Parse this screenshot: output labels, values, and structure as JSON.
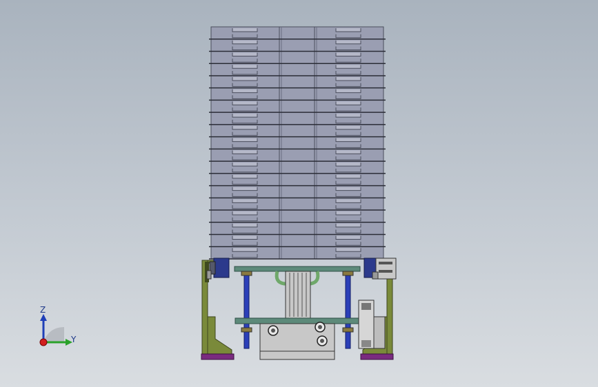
{
  "viewport": {
    "background_top": "#a9b3be",
    "background_bottom": "#d9dde1"
  },
  "model": {
    "trays": {
      "count": 19
    },
    "colors": {
      "tray_fill": "#9a9eb2",
      "tray_line": "#4a4d5c",
      "frame_olive": "#7a8a3a",
      "frame_dark": "#3d4520",
      "base_purple": "#7a2b7f",
      "plate_green": "#5d8a7a",
      "plate_dark": "#2f4f45",
      "guide_rod": "#2b3fb8",
      "motor_blue": "#2c3a8c",
      "cylinder_green": "#6fa86a",
      "block_gray": "#c8c8c8"
    }
  },
  "triad": {
    "z_label": "Z",
    "y_label": "Y",
    "z_color": "#1f3fb8",
    "y_color": "#2aa12a",
    "x_color": "#d21f1f"
  }
}
